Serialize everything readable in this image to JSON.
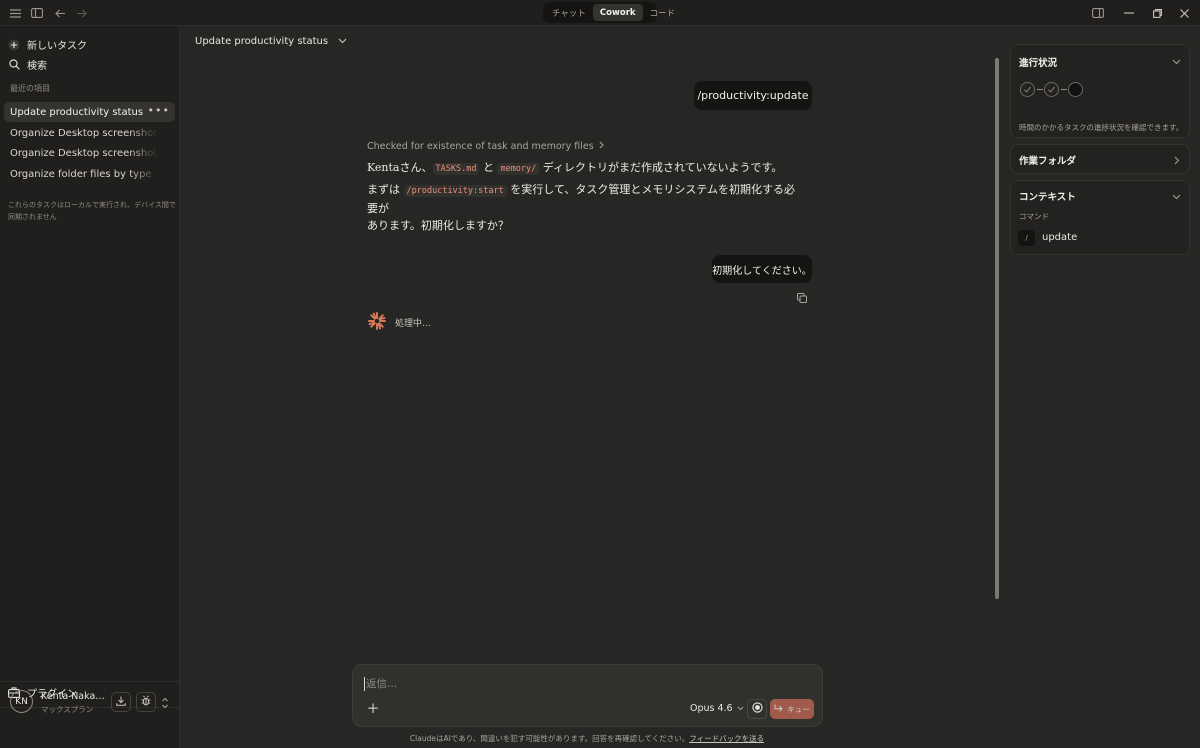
{
  "topbar": {
    "tabs": [
      {
        "label": "チャット",
        "active": false
      },
      {
        "label": "Cowork",
        "active": true
      },
      {
        "label": "コード",
        "active": false
      }
    ]
  },
  "sidebar": {
    "new_task": "新しいタスク",
    "search": "検索",
    "recent_label": "最近の項目",
    "tasks": [
      "Update productivity status",
      "Organize Desktop screenshots and",
      "Organize Desktop screenshots and",
      "Organize folder files by type"
    ],
    "note": "これらのタスクはローカルで実行され、デバイス間で同期されません",
    "plugins": "プラグイン",
    "user": {
      "initials": "KN",
      "name": "Kenta Nakamura",
      "plan": "マックスプラン"
    }
  },
  "main": {
    "title": "Update productivity status",
    "user_msg_1": "/productivity:update",
    "meta": "Checked for existence of task and memory files",
    "reply": {
      "p1_a": "Kentaさん、",
      "code1": "TASKS.md",
      "p1_b": " と ",
      "code2": "memory/",
      "p1_c": " ディレクトリがまだ作成されていないようです。",
      "p2_a": "まずは ",
      "code3": "/productivity:start",
      "p2_b": " を実行して、タスク管理とメモリシステムを初期化する必要が",
      "p2_c": "あります。初期化しますか？"
    },
    "user_msg_2": "初期化してください。",
    "processing": "処理中..."
  },
  "composer": {
    "placeholder": "返信...",
    "model": "Opus 4.6",
    "send_label": "キュー"
  },
  "disclaimer": {
    "text": "ClaudeはAIであり、間違いを犯す可能性があります。回答を再確認してください。",
    "link": "フィードバックを送る"
  },
  "right_panel": {
    "progress_title": "進行状況",
    "progress_note": "時間のかかるタスクの進捗状況を確認できます。",
    "folder_title": "作業フォルダ",
    "context_title": "コンテキスト",
    "command_label": "コマンド",
    "command_name": "update"
  },
  "colors": {
    "accent": "#c96a55",
    "background": "#262624",
    "sidebar": "#201f1d"
  }
}
